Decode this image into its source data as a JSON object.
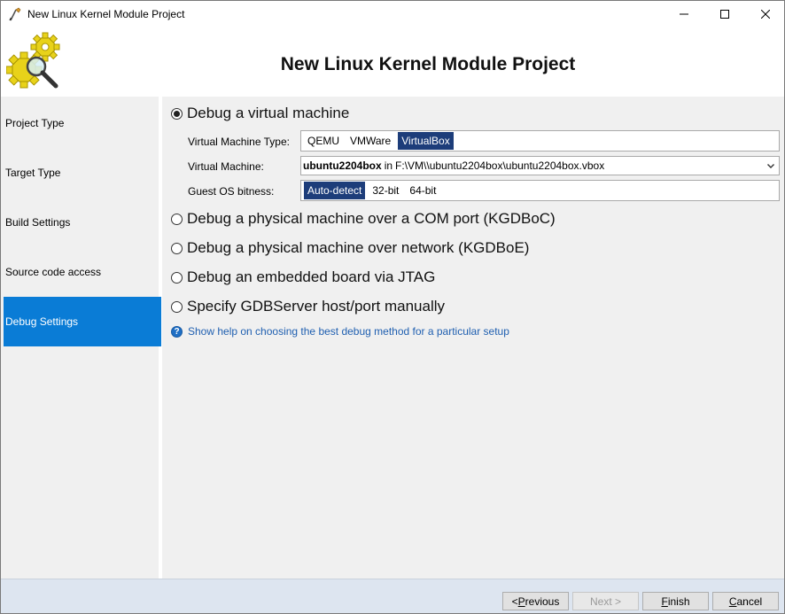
{
  "window": {
    "title": "New Linux Kernel Module Project"
  },
  "header": {
    "title": "New Linux Kernel Module Project"
  },
  "sidebar": {
    "items": [
      {
        "label": "Project Type",
        "active": false
      },
      {
        "label": "Target Type",
        "active": false
      },
      {
        "label": "Build Settings",
        "active": false
      },
      {
        "label": "Source code access",
        "active": false
      },
      {
        "label": "Debug Settings",
        "active": true
      }
    ]
  },
  "debug": {
    "options": [
      {
        "label": "Debug a virtual machine",
        "checked": true
      },
      {
        "label": "Debug a physical machine over a COM port (KGDBoC)",
        "checked": false
      },
      {
        "label": "Debug a physical machine over network (KGDBoE)",
        "checked": false
      },
      {
        "label": "Debug an embedded board via JTAG",
        "checked": false
      },
      {
        "label": "Specify GDBServer host/port manually",
        "checked": false
      }
    ],
    "vm_type": {
      "label": "Virtual Machine Type:",
      "options": [
        "QEMU",
        "VMWare",
        "VirtualBox"
      ],
      "selected": "VirtualBox"
    },
    "vm": {
      "label": "Virtual Machine:",
      "name": "ubuntu2204box",
      "in_text": "in",
      "path": "F:\\VM\\\\ubuntu2204box\\ubuntu2204box.vbox"
    },
    "bitness": {
      "label": "Guest OS bitness:",
      "options": [
        "Auto-detect",
        "32-bit",
        "64-bit"
      ],
      "selected": "Auto-detect"
    },
    "help_link": "Show help on choosing the best debug method for a particular setup"
  },
  "footer": {
    "previous": {
      "prefix": "< ",
      "accel": "P",
      "rest": "revious"
    },
    "next": {
      "label": "Next >"
    },
    "finish": {
      "accel": "F",
      "rest": "inish"
    },
    "cancel": {
      "accel": "C",
      "rest": "ancel"
    }
  },
  "colors": {
    "accent": "#0a7cd6",
    "selected_option": "#1d3d7a",
    "link": "#1f5fb0",
    "footer_bg": "#dde5f0"
  },
  "icons": {
    "app": "pencil-compass-icon",
    "logo": "gears-magnifier-icon",
    "help": "question-icon",
    "combo": "chevron-down-icon"
  }
}
